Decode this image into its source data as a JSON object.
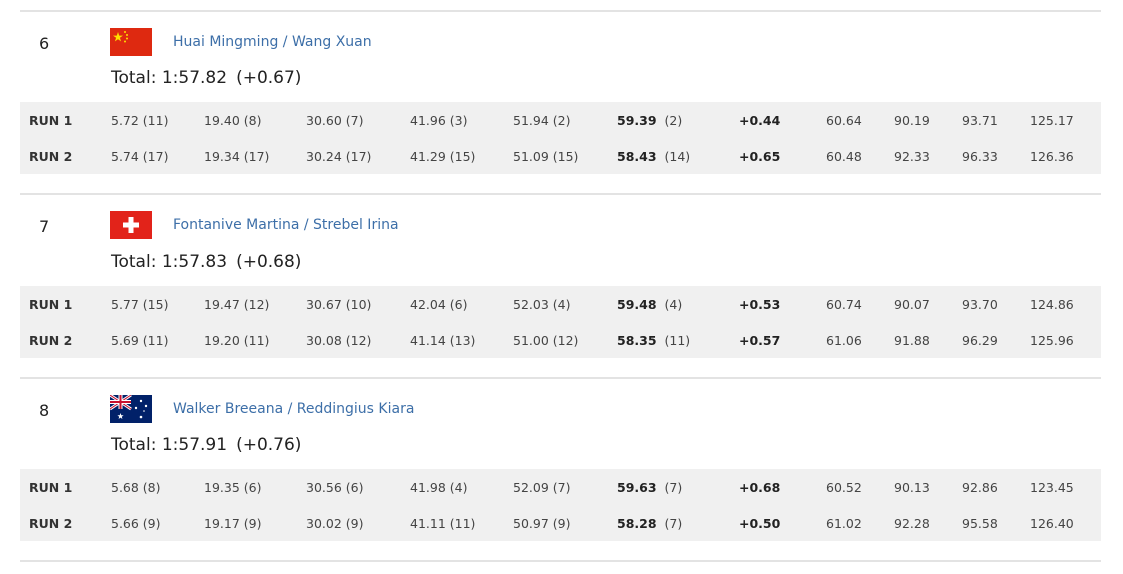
{
  "entries": [
    {
      "rank": "6",
      "country": "CHN",
      "athletes": "Huai Mingming / Wang Xuan",
      "total_label": "Total:",
      "total_time": "1:57.82",
      "total_diff": "(+0.67)",
      "runs": [
        {
          "label": "RUN 1",
          "s1": "5.72 (11)",
          "s2": "19.40 (8)",
          "s3": "30.60 (7)",
          "s4": "41.96 (3)",
          "s5": "51.94 (2)",
          "finish_time": "59.39",
          "finish_rank": "(2)",
          "diff": "+0.44",
          "sp1": "60.64",
          "sp2": "90.19",
          "sp3": "93.71",
          "sp4": "125.17"
        },
        {
          "label": "RUN 2",
          "s1": "5.74 (17)",
          "s2": "19.34 (17)",
          "s3": "30.24 (17)",
          "s4": "41.29 (15)",
          "s5": "51.09 (15)",
          "finish_time": "58.43",
          "finish_rank": "(14)",
          "diff": "+0.65",
          "sp1": "60.48",
          "sp2": "92.33",
          "sp3": "96.33",
          "sp4": "126.36"
        }
      ]
    },
    {
      "rank": "7",
      "country": "SUI",
      "athletes": "Fontanive Martina / Strebel Irina",
      "total_label": "Total:",
      "total_time": "1:57.83",
      "total_diff": "(+0.68)",
      "runs": [
        {
          "label": "RUN 1",
          "s1": "5.77 (15)",
          "s2": "19.47 (12)",
          "s3": "30.67 (10)",
          "s4": "42.04 (6)",
          "s5": "52.03 (4)",
          "finish_time": "59.48",
          "finish_rank": "(4)",
          "diff": "+0.53",
          "sp1": "60.74",
          "sp2": "90.07",
          "sp3": "93.70",
          "sp4": "124.86"
        },
        {
          "label": "RUN 2",
          "s1": "5.69 (11)",
          "s2": "19.20 (11)",
          "s3": "30.08 (12)",
          "s4": "41.14 (13)",
          "s5": "51.00 (12)",
          "finish_time": "58.35",
          "finish_rank": "(11)",
          "diff": "+0.57",
          "sp1": "61.06",
          "sp2": "91.88",
          "sp3": "96.29",
          "sp4": "125.96"
        }
      ]
    },
    {
      "rank": "8",
      "country": "AUS",
      "athletes": "Walker Breeana / Reddingius Kiara",
      "total_label": "Total:",
      "total_time": "1:57.91",
      "total_diff": "(+0.76)",
      "runs": [
        {
          "label": "RUN 1",
          "s1": "5.68 (8)",
          "s2": "19.35 (6)",
          "s3": "30.56 (6)",
          "s4": "41.98 (4)",
          "s5": "52.09 (7)",
          "finish_time": "59.63",
          "finish_rank": "(7)",
          "diff": "+0.68",
          "sp1": "60.52",
          "sp2": "90.13",
          "sp3": "92.86",
          "sp4": "123.45"
        },
        {
          "label": "RUN 2",
          "s1": "5.66 (9)",
          "s2": "19.17 (9)",
          "s3": "30.02 (9)",
          "s4": "41.11 (11)",
          "s5": "50.97 (9)",
          "finish_time": "58.28",
          "finish_rank": "(7)",
          "diff": "+0.50",
          "sp1": "61.02",
          "sp2": "92.28",
          "sp3": "95.58",
          "sp4": "126.40"
        }
      ]
    }
  ],
  "colors": {
    "athlete_link": "#3d6fa8",
    "run_band": "#f0f0f0",
    "divider": "#e3e3e3",
    "flag_red": "#de2910",
    "flag_yellow": "#ffde00",
    "flag_swiss_red": "#e2231a",
    "flag_aus_blue": "#012169"
  }
}
